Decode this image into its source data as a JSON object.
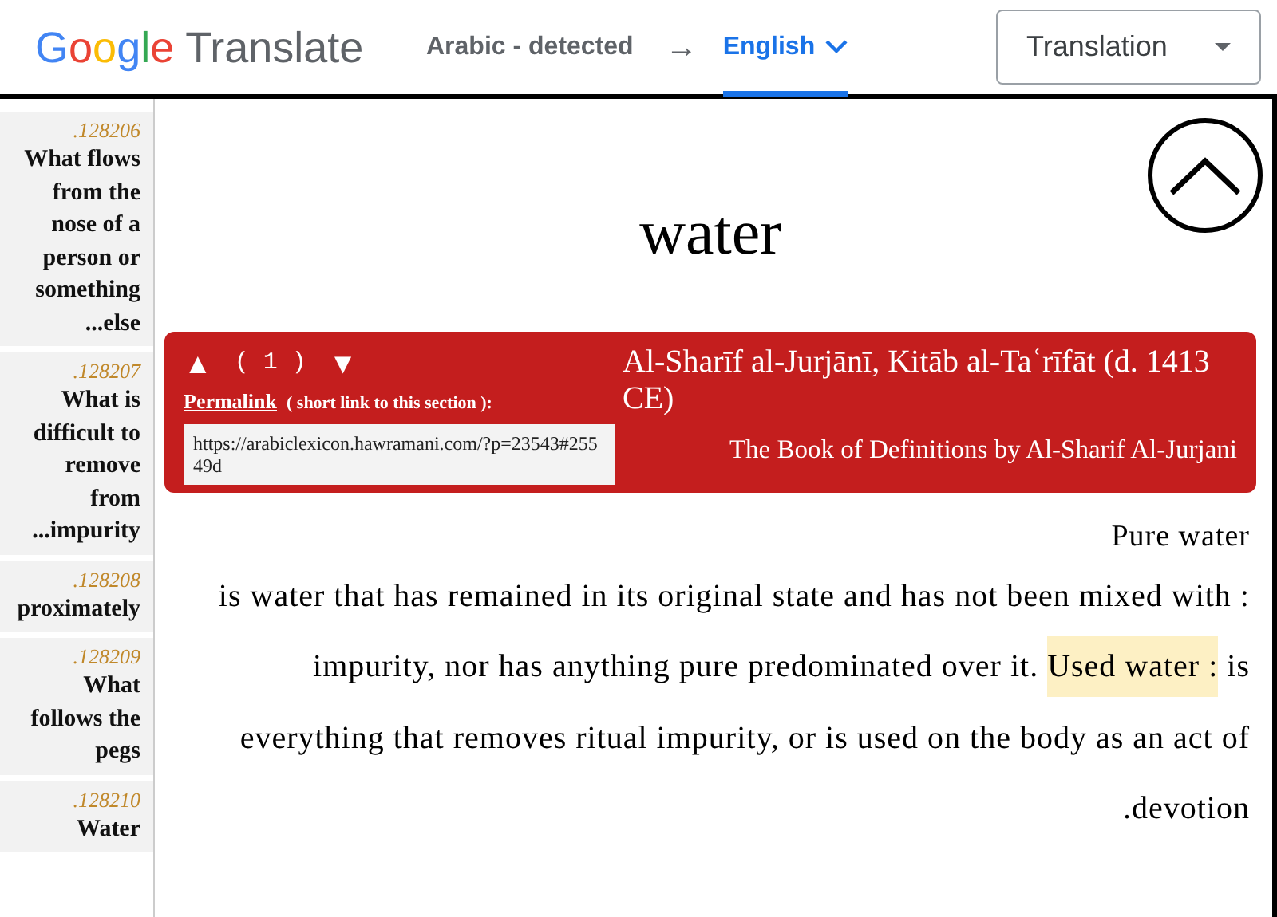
{
  "header": {
    "logo": {
      "letters": [
        {
          "char": "G",
          "color": "#4285f4"
        },
        {
          "char": "o",
          "color": "#ea4335"
        },
        {
          "char": "o",
          "color": "#fbbc05"
        },
        {
          "char": "g",
          "color": "#4285f4"
        },
        {
          "char": "l",
          "color": "#34a853"
        },
        {
          "char": "e",
          "color": "#ea4335"
        }
      ],
      "product": "Translate"
    },
    "source_language": "Arabic - detected",
    "arrow": "→",
    "target_language": {
      "label": "English",
      "selected": true
    },
    "mode_select": {
      "value": "Translation"
    }
  },
  "sidebar": {
    "items": [
      {
        "number": ".128206",
        "title": "What flows from the nose of a person or something ...else"
      },
      {
        "number": ".128207",
        "title": "What is difficult to remove from ...impurity"
      },
      {
        "number": ".128208",
        "title": "proximately"
      },
      {
        "number": ".128209",
        "title": "What follows the pegs"
      },
      {
        "number": ".128210",
        "title": "Water"
      }
    ]
  },
  "entry": {
    "headword": "water",
    "source_banner": {
      "up": "▲",
      "counter": "( 1 )",
      "down": "▼",
      "permalink": "Permalink",
      "permalink_note": "( short link to this section ):",
      "url": "https://arabiclexicon.hawramani.com/?p=23543#25549d",
      "title": "Al-Sharīf al-Jurjānī, Kitāb al-Taʿrīfāt (d. 1413 CE)",
      "subtitle": "The Book of Definitions by Al-Sharif Al-Jurjani"
    },
    "term": "Pure water",
    "definition_lines": [
      [
        {
          "text": "is water that has remained in its original state and has not been mixed with :",
          "highlighted": false
        }
      ],
      [
        {
          "text": "impurity, nor has anything pure predominated over it. ",
          "highlighted": false
        },
        {
          "text": "Used water :",
          "highlighted": true
        },
        {
          "text": " is",
          "highlighted": false
        }
      ],
      [
        {
          "text": "everything that removes ritual impurity, or is used on the body as an act of",
          "highlighted": false
        }
      ],
      [
        {
          "text": ".devotion",
          "highlighted": false
        }
      ]
    ]
  }
}
